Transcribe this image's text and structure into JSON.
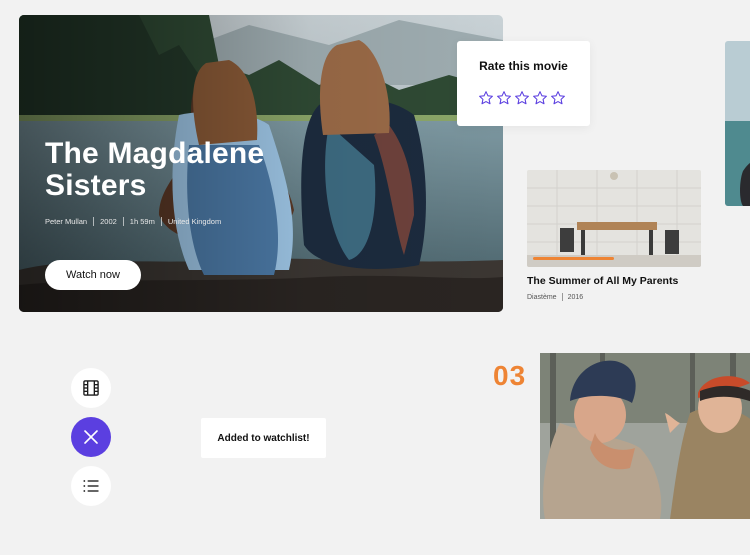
{
  "hero": {
    "title": "The Magdalene Sisters",
    "meta": {
      "director": "Peter Mullan",
      "year": "2002",
      "duration": "1h 59m",
      "country": "United Kingdom"
    },
    "watch_label": "Watch now"
  },
  "rating": {
    "title": "Rate this movie",
    "star_count": 5,
    "filled": 0,
    "accent": "#5b3fe0"
  },
  "movie_card": {
    "title": "The Summer of All My Parents",
    "director": "Diastème",
    "year": "2016",
    "progress": 0.5,
    "progress_color": "#ee8434"
  },
  "toast": {
    "message": "Added to watchlist!"
  },
  "rank": {
    "number": "03",
    "color": "#ee8434"
  },
  "icons": {
    "film": "film-icon",
    "close": "close-icon",
    "list": "list-icon"
  }
}
